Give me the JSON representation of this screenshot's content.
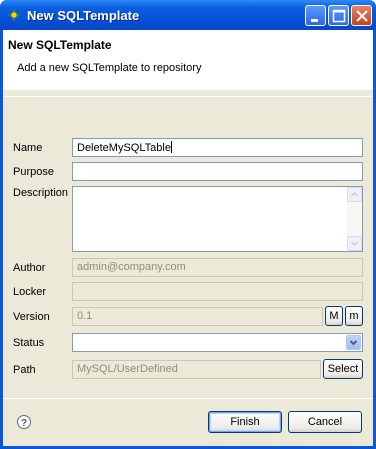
{
  "window": {
    "title": "New SQLTemplate"
  },
  "header": {
    "title": "New SQLTemplate",
    "subtitle": "Add a new SQLTemplate to repository"
  },
  "form": {
    "name": {
      "label": "Name",
      "value": "DeleteMySQLTable"
    },
    "purpose": {
      "label": "Purpose",
      "value": ""
    },
    "description": {
      "label": "Description",
      "value": ""
    },
    "author": {
      "label": "Author",
      "value": "admin@company.com"
    },
    "locker": {
      "label": "Locker",
      "value": ""
    },
    "version": {
      "label": "Version",
      "value": "0.1",
      "major_button": "M",
      "minor_button": "m"
    },
    "status": {
      "label": "Status",
      "value": ""
    },
    "path": {
      "label": "Path",
      "value": "MySQL/UserDefined",
      "select_button": "Select"
    }
  },
  "footer": {
    "finish_label": "Finish",
    "cancel_label": "Cancel",
    "help_icon": "help-icon"
  },
  "colors": {
    "titlebar": "#0a58d8",
    "dialog_bg": "#ece9d8",
    "field_border": "#7f9db9"
  }
}
